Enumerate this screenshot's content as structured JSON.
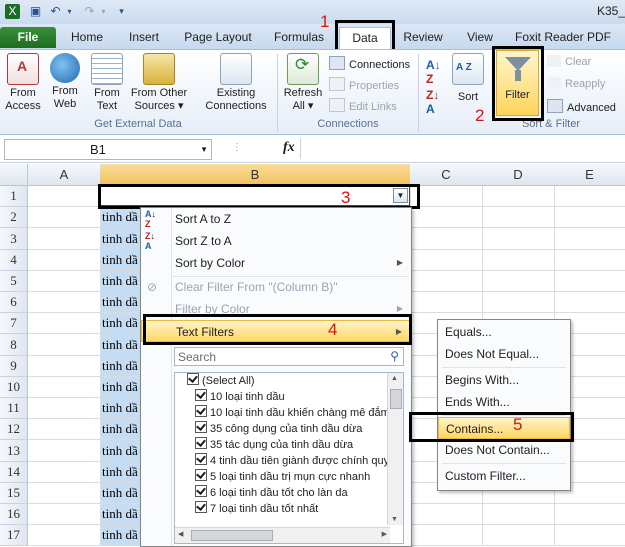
{
  "window": {
    "title": "K35_"
  },
  "tabs": [
    {
      "label": "File"
    },
    {
      "label": "Home"
    },
    {
      "label": "Insert"
    },
    {
      "label": "Page Layout"
    },
    {
      "label": "Formulas"
    },
    {
      "label": "Data"
    },
    {
      "label": "Review"
    },
    {
      "label": "View"
    },
    {
      "label": "Foxit Reader PDF"
    }
  ],
  "ribbon": {
    "get_external": {
      "from_access": [
        "From",
        "Access"
      ],
      "from_web": [
        "From",
        "Web"
      ],
      "from_text": [
        "From",
        "Text"
      ],
      "from_other": [
        "From Other",
        "Sources ▾"
      ],
      "existing": [
        "Existing",
        "Connections"
      ],
      "group_label": "Get External Data"
    },
    "connections": {
      "refresh": [
        "Refresh",
        "All ▾"
      ],
      "connections": "Connections",
      "properties": "Properties",
      "edit_links": "Edit Links",
      "group_label": "Connections"
    },
    "sort_filter": {
      "sort": "Sort",
      "filter": "Filter",
      "clear": "Clear",
      "reapply": "Reapply",
      "advanced": "Advanced",
      "group_label": "Sort & Filter"
    }
  },
  "formula_bar": {
    "name_box": "B1",
    "fx": "fx"
  },
  "columns": [
    "A",
    "B",
    "C",
    "D",
    "E"
  ],
  "rows": [
    "1",
    "2",
    "3",
    "4",
    "5",
    "6",
    "7",
    "8",
    "9",
    "10",
    "11",
    "12",
    "13",
    "14",
    "15",
    "16",
    "17"
  ],
  "cell_text": "tinh dầ",
  "filter_menu": {
    "sort_az": "Sort A to Z",
    "sort_za": "Sort Z to A",
    "sort_color": "Sort by Color",
    "clear_filter": "Clear Filter From \"(Column B)\"",
    "filter_color": "Filter by Color",
    "text_filters": "Text Filters",
    "search_placeholder": "Search",
    "items": [
      "(Select All)",
      "10 loại tinh dầu",
      "10 loại tinh dầu khiến chàng mê đắm",
      "35 công dụng của tinh dầu dừa",
      "35 tác dụng của tinh dầu dừa",
      "4 tinh dầu tiên giành được chính quy",
      "5 loại tinh dầu trị mụn cực nhanh",
      "6 loại tinh dầu tốt cho làn da",
      "7 loại tinh dầu tốt nhất"
    ]
  },
  "text_filters_menu": {
    "equals": "Equals...",
    "not_equal": "Does Not Equal...",
    "begins": "Begins With...",
    "ends": "Ends With...",
    "contains": "Contains...",
    "not_contains": "Does Not Contain...",
    "custom": "Custom Filter..."
  },
  "steps": [
    "1",
    "2",
    "3",
    "4",
    "5"
  ],
  "colors": {
    "highlight": "#ffd863",
    "step_number": "#e01010",
    "selected_column": "#c6dcf3"
  }
}
